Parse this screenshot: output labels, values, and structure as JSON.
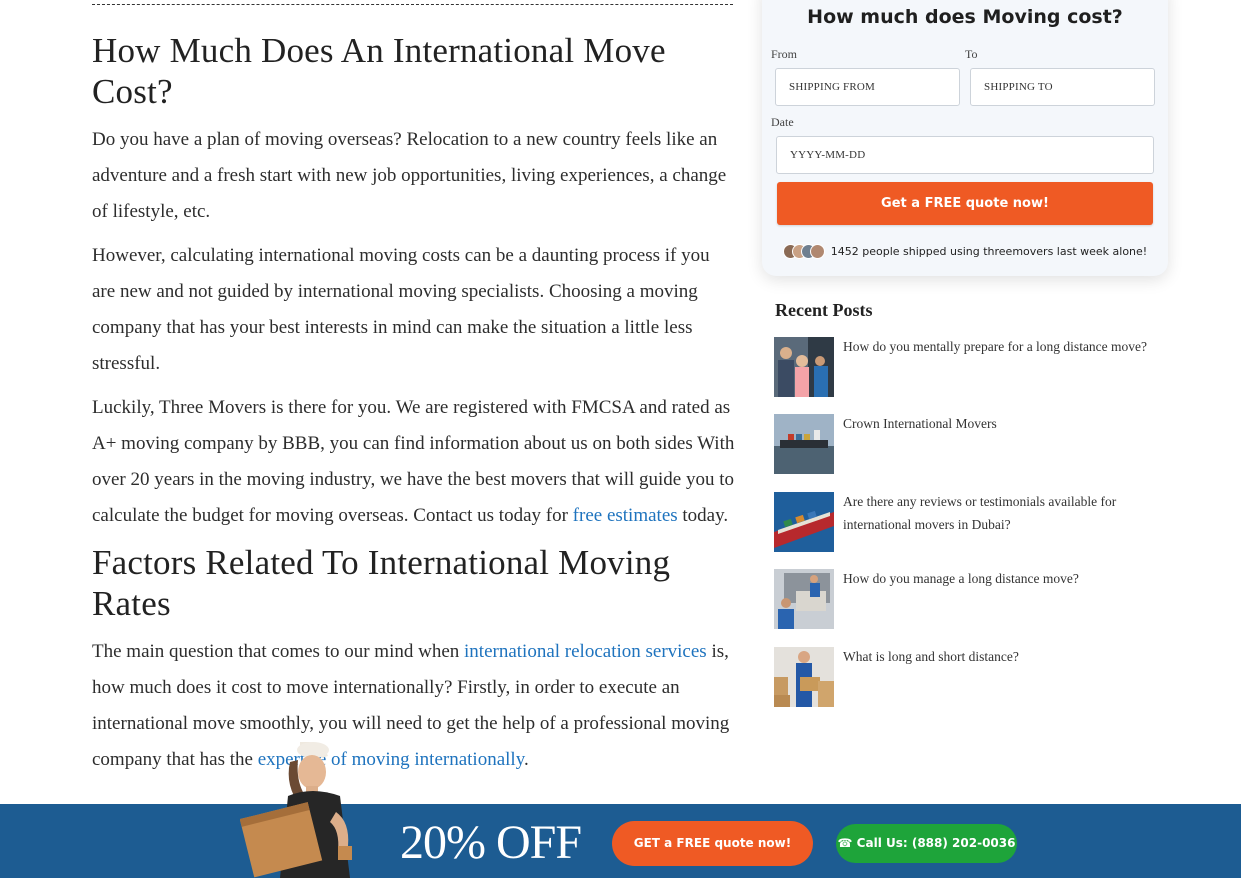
{
  "article": {
    "heading_cost": "How Much Does An International Move Cost?",
    "p1": "Do you have a plan of moving overseas? Relocation to a new country feels like an adventure and a fresh start with new job opportunities, living experiences, a change of lifestyle, etc.",
    "p2": "However, calculating international moving costs can be a daunting process if you are new and not guided by international moving specialists. Choosing a moving company that has your best interests in mind can make the situation a little less stressful.",
    "p3_text": "Luckily, Three Movers is there for you. We are registered with FMCSA and rated as A+ moving company by BBB, you can find information about us on both sides With over 20 years in the moving industry, we have the best movers that will guide you to calculate the budget for moving overseas. Contact us today for ",
    "p3_link": "free estimates",
    "p3_end": " today.",
    "heading_factors": "Factors Related To International Moving Rates",
    "p4_a": "The main question that comes to our mind when ",
    "p4_link1": "international relocation services",
    "p4_b": "  is, how much does it cost to move internationally? Firstly, in order to execute an international move smoothly, you will need to get the help of a professional moving company that has the ",
    "p4_link2": "expertise of moving internationally",
    "p4_c": "."
  },
  "quote_form": {
    "title": "How much does Moving cost?",
    "from_label": "From",
    "to_label": "To",
    "from_placeholder": "SHIPPING FROM",
    "to_placeholder": "SHIPPING TO",
    "date_label": "Date",
    "date_placeholder": "YYYY-MM-DD",
    "submit_label": "Get a FREE quote now!",
    "social_proof": "1452 people shipped using threemovers last week alone!"
  },
  "recent_posts": {
    "title": "Recent Posts",
    "items": [
      {
        "title": "How do you mentally prepare for a long distance move?"
      },
      {
        "title": "Crown International Movers"
      },
      {
        "title": "Are there any reviews or testimonials available for international movers in Dubai?"
      },
      {
        "title": "How do you manage a long distance move?"
      },
      {
        "title": "What is long and short distance?"
      }
    ]
  },
  "banner": {
    "offer": "20% OFF",
    "quote_button": "GET a FREE quote now!",
    "call_button": "Call Us: (888) 202-0036"
  },
  "colors": {
    "accent_orange": "#ef5a24",
    "banner_blue": "#1d5c92",
    "call_green": "#1ea43a",
    "link_blue": "#1e73be"
  }
}
